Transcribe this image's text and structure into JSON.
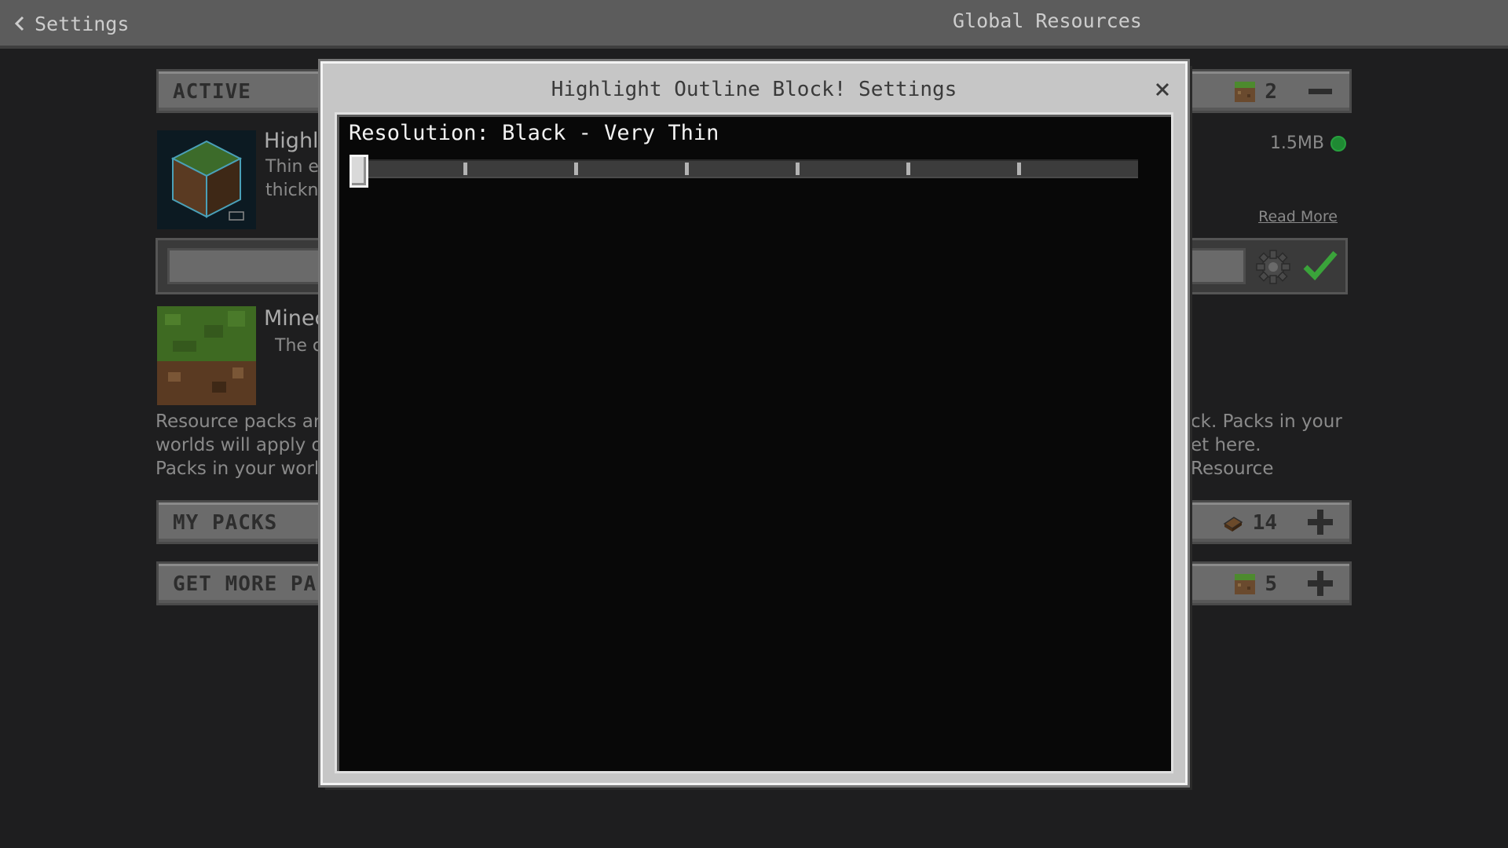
{
  "topbar": {
    "back_label": "Settings",
    "title": "Global Resources"
  },
  "sections": {
    "active": {
      "label": "ACTIVE",
      "count": "2"
    },
    "my_packs": {
      "label": "MY PACKS",
      "count": "14"
    },
    "get_more": {
      "label": "GET MORE PAC",
      "count": "5"
    }
  },
  "packs": [
    {
      "title": "Highl",
      "desc_line1": "Thin e",
      "desc_line2": "thickn",
      "size": "1.5MB",
      "read_more": "Read More"
    },
    {
      "title": "Minec",
      "desc_line1": "The c"
    }
  ],
  "info": {
    "left_lines": [
      "Resource packs are",
      "worlds will apply o",
      "Packs in your world"
    ],
    "right_lines": [
      "ck. Packs in your",
      "et here. Resource",
      ""
    ]
  },
  "modal": {
    "title": "Highlight Outline Block! Settings",
    "setting_label": "Resolution: Black - Very Thin",
    "slider": {
      "steps": 7,
      "value_index": 0
    }
  },
  "colors": {
    "accent_green": "#1f8a33",
    "check_green": "#3aa33a"
  },
  "icons": {
    "back": "chevron-left-icon",
    "close": "close-icon",
    "gear": "gear-icon",
    "check": "check-icon"
  }
}
